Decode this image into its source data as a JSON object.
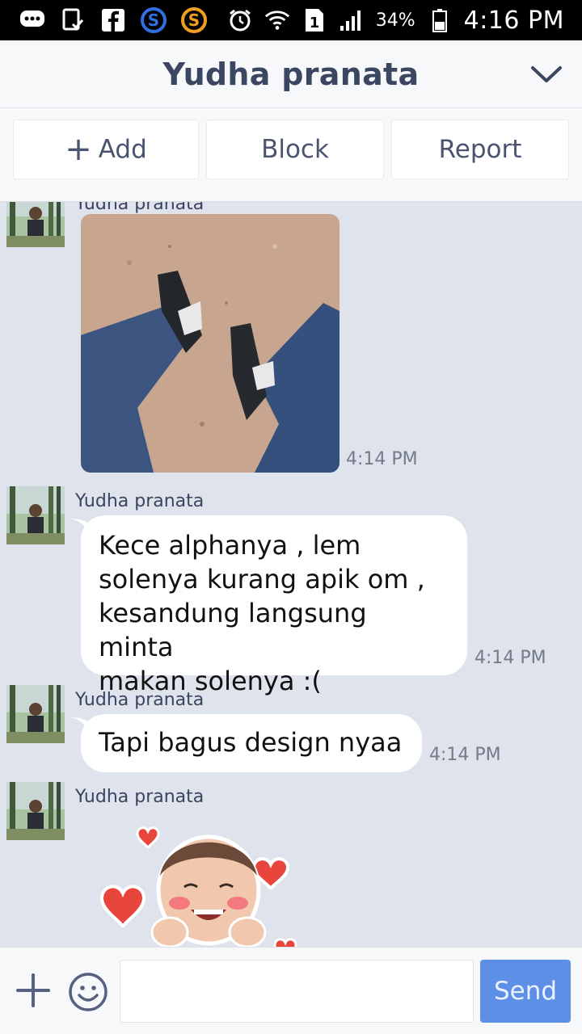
{
  "status_bar": {
    "battery": "34%",
    "time": "4:16 PM",
    "sim_badge": "1",
    "icons": [
      "messages-icon",
      "download-check-icon",
      "facebook-icon",
      "s-app-blue-icon",
      "s-app-orange-icon",
      "alarm-icon",
      "wifi-icon",
      "sim-icon",
      "signal-icon",
      "battery-icon"
    ]
  },
  "header": {
    "title": "Yudha pranata"
  },
  "actions": {
    "add_label": "Add",
    "block_label": "Block",
    "report_label": "Report"
  },
  "messages": [
    {
      "sender": "Yudha pranata",
      "type": "image",
      "time": "4:14 PM"
    },
    {
      "sender": "Yudha pranata",
      "type": "text",
      "lines": [
        "Kece alphanya , lem",
        "solenya kurang apik om ,",
        "kesandung langsung minta",
        "makan solenya :("
      ],
      "time": "4:14 PM"
    },
    {
      "sender": "Yudha pranata",
      "type": "text",
      "lines": [
        "Tapi bagus design nyaa"
      ],
      "time": "4:14 PM"
    },
    {
      "sender": "Yudha pranata",
      "type": "sticker"
    }
  ],
  "composer": {
    "input_value": "",
    "send_label": "Send"
  },
  "colors": {
    "chat_background": "#dfe3ec",
    "send_button": "#5e8fe6",
    "title_text": "#3b4660"
  }
}
